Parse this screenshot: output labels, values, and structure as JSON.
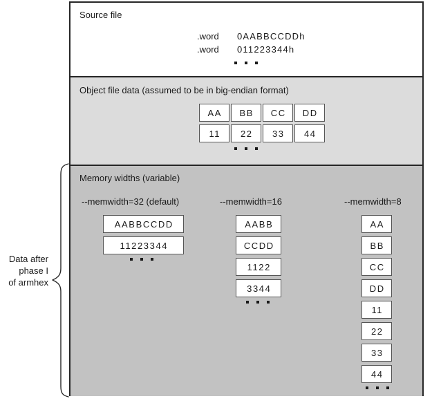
{
  "caption": {
    "lines": [
      "Data after",
      "phase I",
      "of armhex"
    ]
  },
  "sections": {
    "source": {
      "title": "Source file",
      "rows": [
        {
          "directive": ".word",
          "value": "0AABBCCDDh"
        },
        {
          "directive": ".word",
          "value": "011223344h"
        }
      ],
      "ellipsis": "• • •"
    },
    "object": {
      "title": "Object file data (assumed to be in big-endian format)",
      "rows": [
        [
          "AA",
          "BB",
          "CC",
          "DD"
        ],
        [
          "11",
          "22",
          "33",
          "44"
        ]
      ],
      "ellipsis": "• • •"
    },
    "memory": {
      "title": "Memory widths (variable)",
      "columns": [
        {
          "header": "--memwidth=32 (default)",
          "boxes": [
            "AABBCCDD",
            "11223344"
          ]
        },
        {
          "header": "--memwidth=16",
          "boxes": [
            "AABB",
            "CCDD",
            "1122",
            "3344"
          ]
        },
        {
          "header": "--memwidth=8",
          "boxes": [
            "AA",
            "BB",
            "CC",
            "DD",
            "11",
            "22",
            "33",
            "44"
          ]
        }
      ],
      "ellipsis": "• • •"
    }
  },
  "colors": {
    "border": "#262626",
    "section_white": "#ffffff",
    "section_light_gray": "#dcdcdc",
    "section_dark_gray": "#c2c2c2",
    "box_border": "#555555",
    "text": "#1a1a1a"
  }
}
